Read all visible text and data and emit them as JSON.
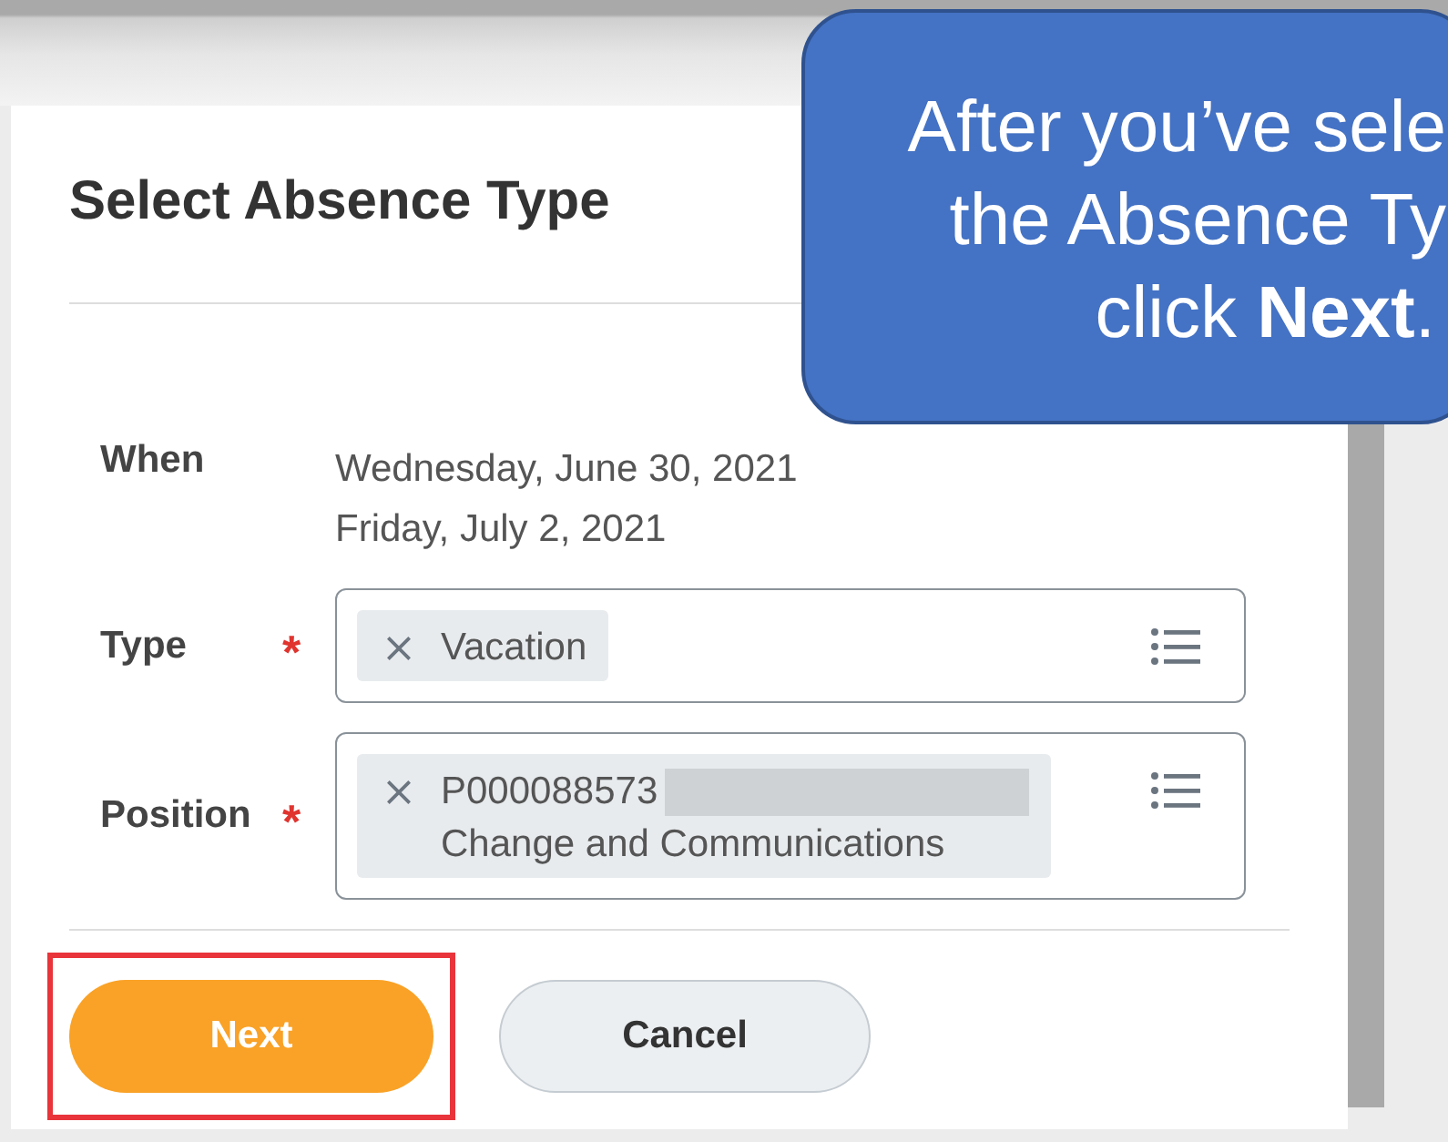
{
  "dialog": {
    "title": "Select Absence Type",
    "when": {
      "label": "When",
      "lines": [
        "Wednesday, June 30, 2021",
        "Friday, July 2, 2021"
      ]
    },
    "fields": [
      {
        "label": "Type",
        "required_mark": "*",
        "values": [
          "Vacation"
        ],
        "redacted": false
      },
      {
        "label": "Position",
        "required_mark": "*",
        "values": [
          "P000088573",
          "Change and Communications"
        ],
        "redacted": true
      }
    ],
    "buttons": [
      {
        "label": "Next",
        "kind": "primary",
        "highlighted": true
      },
      {
        "label": "Cancel",
        "kind": "secondary",
        "highlighted": false
      }
    ]
  },
  "callout": {
    "lines": [
      "After you’ve sele",
      "the Absence Ty",
      "click **Next**."
    ]
  }
}
